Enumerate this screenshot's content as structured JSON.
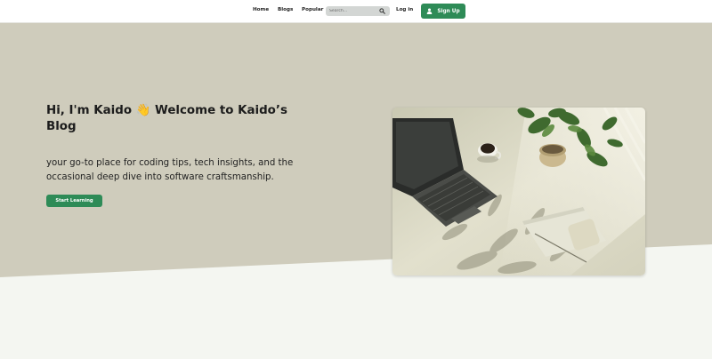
{
  "nav": {
    "links": [
      "Home",
      "Blogs",
      "Popular"
    ],
    "search_placeholder": "Search...",
    "login_label": "Log in",
    "signup_label": "Sign Up"
  },
  "hero": {
    "title": "Hi, I'm Kaido 👋 Welcome to Kaido’s Blog",
    "subtitle": "your go-to place for coding tips, tech insights, and the occasional deep dive into software craftsmanship.",
    "cta_label": "Start Learning"
  },
  "colors": {
    "accent": "#2e8b57",
    "hero_background": "#cfccbc",
    "page_background": "#f4f6f1"
  },
  "icons": {
    "search": "search-icon",
    "signup": "user-icon"
  }
}
